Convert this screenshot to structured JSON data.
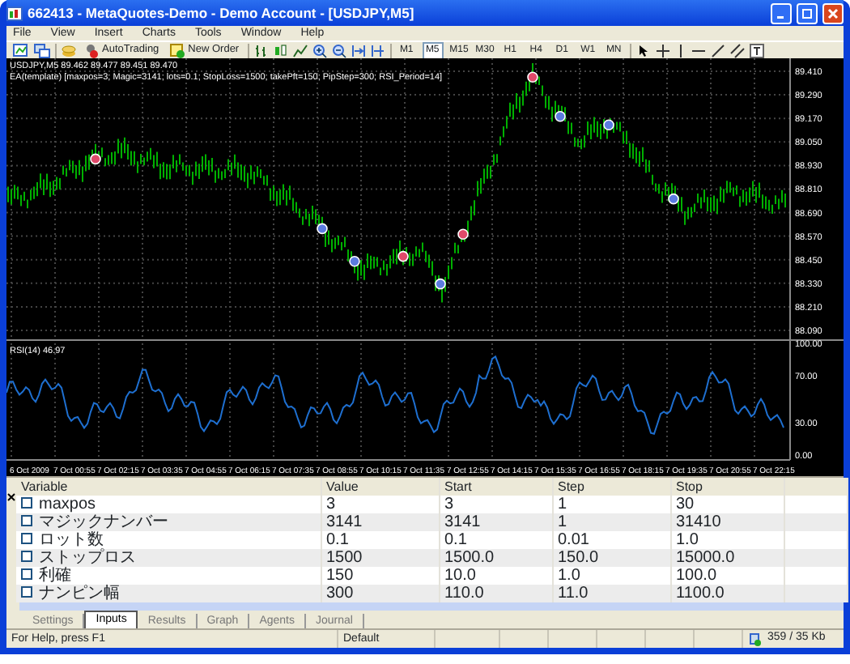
{
  "window": {
    "title": "662413 - MetaQuotes-Demo - Demo Account - [USDJPY,M5]"
  },
  "menu": [
    "File",
    "View",
    "Insert",
    "Charts",
    "Tools",
    "Window",
    "Help"
  ],
  "toolbar": {
    "buttons": [
      {
        "kind": "autotrading",
        "label": "AutoTrading"
      },
      {
        "kind": "order",
        "label": "New Order"
      }
    ],
    "timeframes": [
      {
        "label": "M1",
        "selected": false
      },
      {
        "label": "M5",
        "selected": true
      },
      {
        "label": "M15",
        "selected": false
      },
      {
        "label": "M30",
        "selected": false
      },
      {
        "label": "H1",
        "selected": false
      },
      {
        "label": "H4",
        "selected": false
      },
      {
        "label": "D1",
        "selected": false
      },
      {
        "label": "W1",
        "selected": false
      },
      {
        "label": "MN",
        "selected": false
      }
    ]
  },
  "chart": {
    "header": "USDJPY,M5 89.462 89.477 89.451 89.470",
    "ea_label": "EA(template) [maxpos=3; Magic=3141; lots=0.1; StopLoss=1500; takePft=150; PipStep=300; RSI_Period=14]",
    "price_ticks": [
      "89.410",
      "89.290",
      "89.170",
      "89.050",
      "88.930",
      "88.810",
      "88.690",
      "88.570",
      "88.450",
      "88.330",
      "88.210",
      "88.090"
    ],
    "rsi_label": "RSI(14) 46.97",
    "rsi_ticks": [
      "100.00",
      "70.00",
      "30.00",
      "0.00"
    ],
    "time_labels": [
      "6 Oct 2009",
      "7 Oct 00:55",
      "7 Oct 02:15",
      "7 Oct 03:35",
      "7 Oct 04:55",
      "7 Oct 06:15",
      "7 Oct 07:35",
      "7 Oct 08:55",
      "7 Oct 10:15",
      "7 Oct 11:35",
      "7 Oct 12:55",
      "7 Oct 14:15",
      "7 Oct 15:35",
      "7 Oct 16:55",
      "7 Oct 18:15",
      "7 Oct 19:35",
      "7 Oct 20:55",
      "7 Oct 22:15"
    ]
  },
  "tester": {
    "columns": [
      "Variable",
      "Value",
      "Start",
      "Step",
      "Stop"
    ],
    "rows": [
      {
        "checked": false,
        "cells": [
          "maxpos",
          "3",
          "3",
          "1",
          "30"
        ]
      },
      {
        "checked": false,
        "cells": [
          "マジックナンバー",
          "3141",
          "3141",
          "1",
          "31410"
        ]
      },
      {
        "checked": false,
        "cells": [
          "ロット数",
          "0.1",
          "0.1",
          "0.01",
          "1.0"
        ]
      },
      {
        "checked": false,
        "cells": [
          "ストップロス",
          "1500",
          "1500.0",
          "150.0",
          "15000.0"
        ]
      },
      {
        "checked": false,
        "cells": [
          "利確",
          "150",
          "10.0",
          "1.0",
          "100.0"
        ]
      },
      {
        "checked": false,
        "cells": [
          "ナンピン幅",
          "300",
          "110.0",
          "11.0",
          "1100.0"
        ]
      }
    ],
    "tabs": [
      {
        "label": "Settings",
        "selected": false
      },
      {
        "label": "Inputs",
        "selected": true
      },
      {
        "label": "Results",
        "selected": false
      },
      {
        "label": "Graph",
        "selected": false
      },
      {
        "label": "Agents",
        "selected": false
      },
      {
        "label": "Journal",
        "selected": false
      }
    ]
  },
  "status_bar": {
    "help": "For Help, press F1",
    "profile": "Default",
    "traffic": "359 / 35 Kb"
  }
}
